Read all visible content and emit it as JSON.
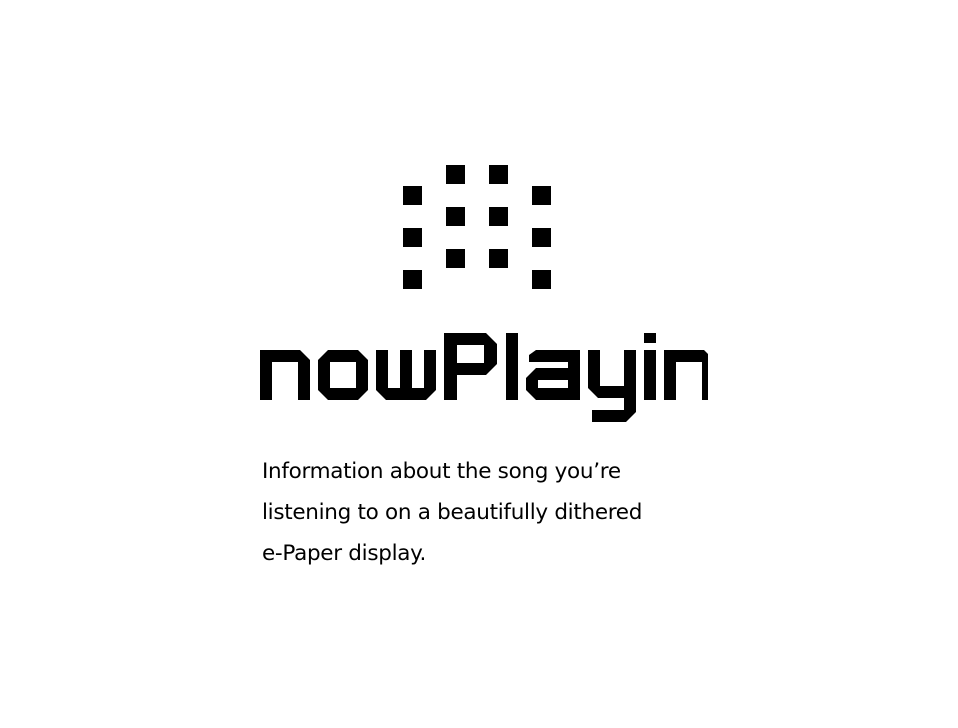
{
  "app": {
    "name": "nowPlaying",
    "logo_icon": "dot-matrix-logo-icon"
  },
  "description": {
    "lines": [
      "Information about the song you’re",
      "listening to on a beautifully dithered",
      "e-Paper display."
    ]
  },
  "colors": {
    "background": "#ffffff",
    "foreground": "#000000"
  }
}
